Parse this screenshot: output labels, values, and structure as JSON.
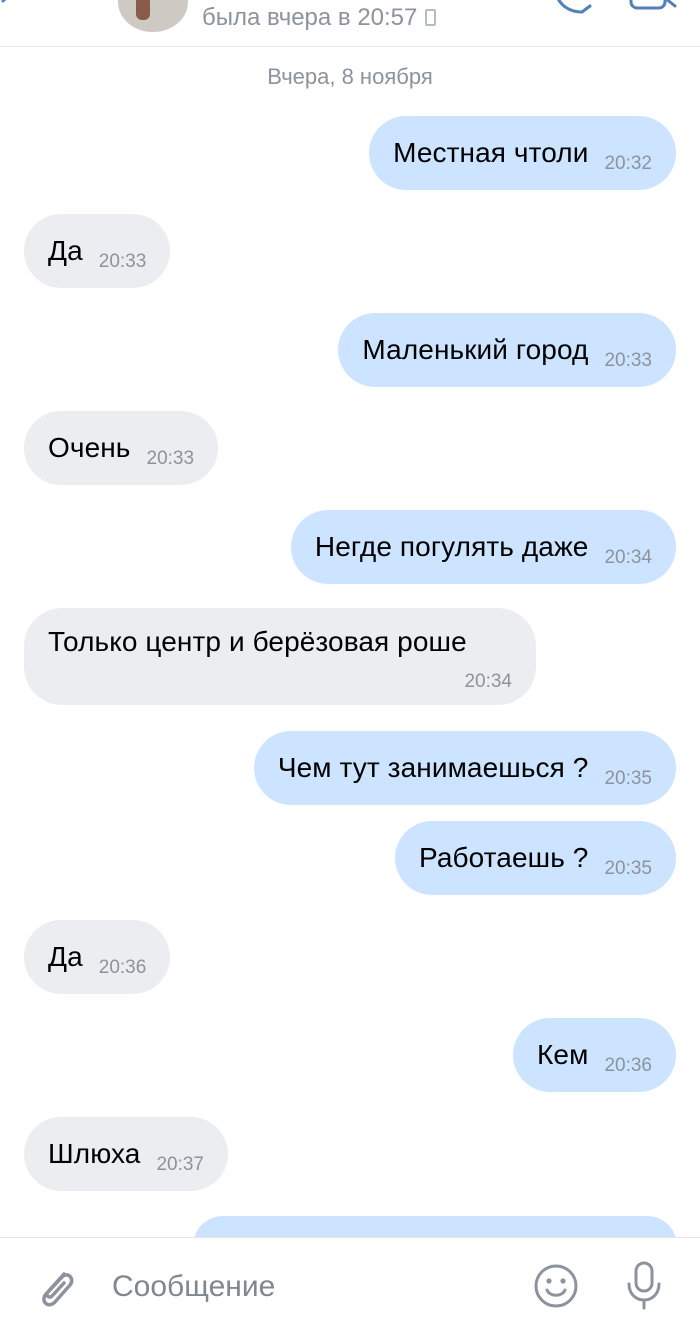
{
  "header": {
    "status": "была вчера в 20:57",
    "status_device": "phone-icon",
    "icons": [
      "back-arrow-icon",
      "call-icon",
      "video-call-icon"
    ]
  },
  "date_separator": "Вчера, 8 ноября",
  "messages": [
    {
      "direction": "out",
      "text": "Местная чтоли",
      "time": "20:32"
    },
    {
      "direction": "in",
      "text": "Да",
      "time": "20:33"
    },
    {
      "direction": "out",
      "text": "Маленький город",
      "time": "20:33"
    },
    {
      "direction": "in",
      "text": "Очень",
      "time": "20:33"
    },
    {
      "direction": "out",
      "text": "Негде погулять даже",
      "time": "20:34"
    },
    {
      "direction": "in",
      "text": "Только центр и берёзовая роше",
      "time": "20:34"
    },
    {
      "direction": "out",
      "text": "Чем тут занимаешься ?",
      "time": "20:35"
    },
    {
      "direction": "out",
      "text": "Работаешь ?",
      "time": "20:35"
    },
    {
      "direction": "in",
      "text": "Да",
      "time": "20:36"
    },
    {
      "direction": "out",
      "text": "Кем",
      "time": "20:36"
    },
    {
      "direction": "in",
      "text": "Шлюха",
      "time": "20:37"
    }
  ],
  "composer": {
    "placeholder": "Сообщение",
    "value": "",
    "icons": [
      "attach-icon",
      "emoji-icon",
      "microphone-icon"
    ]
  },
  "colors": {
    "outgoing_bubble": "#cce4ff",
    "incoming_bubble": "#ebedf0",
    "meta_text": "#8c939c",
    "accent": "#5181b8"
  }
}
